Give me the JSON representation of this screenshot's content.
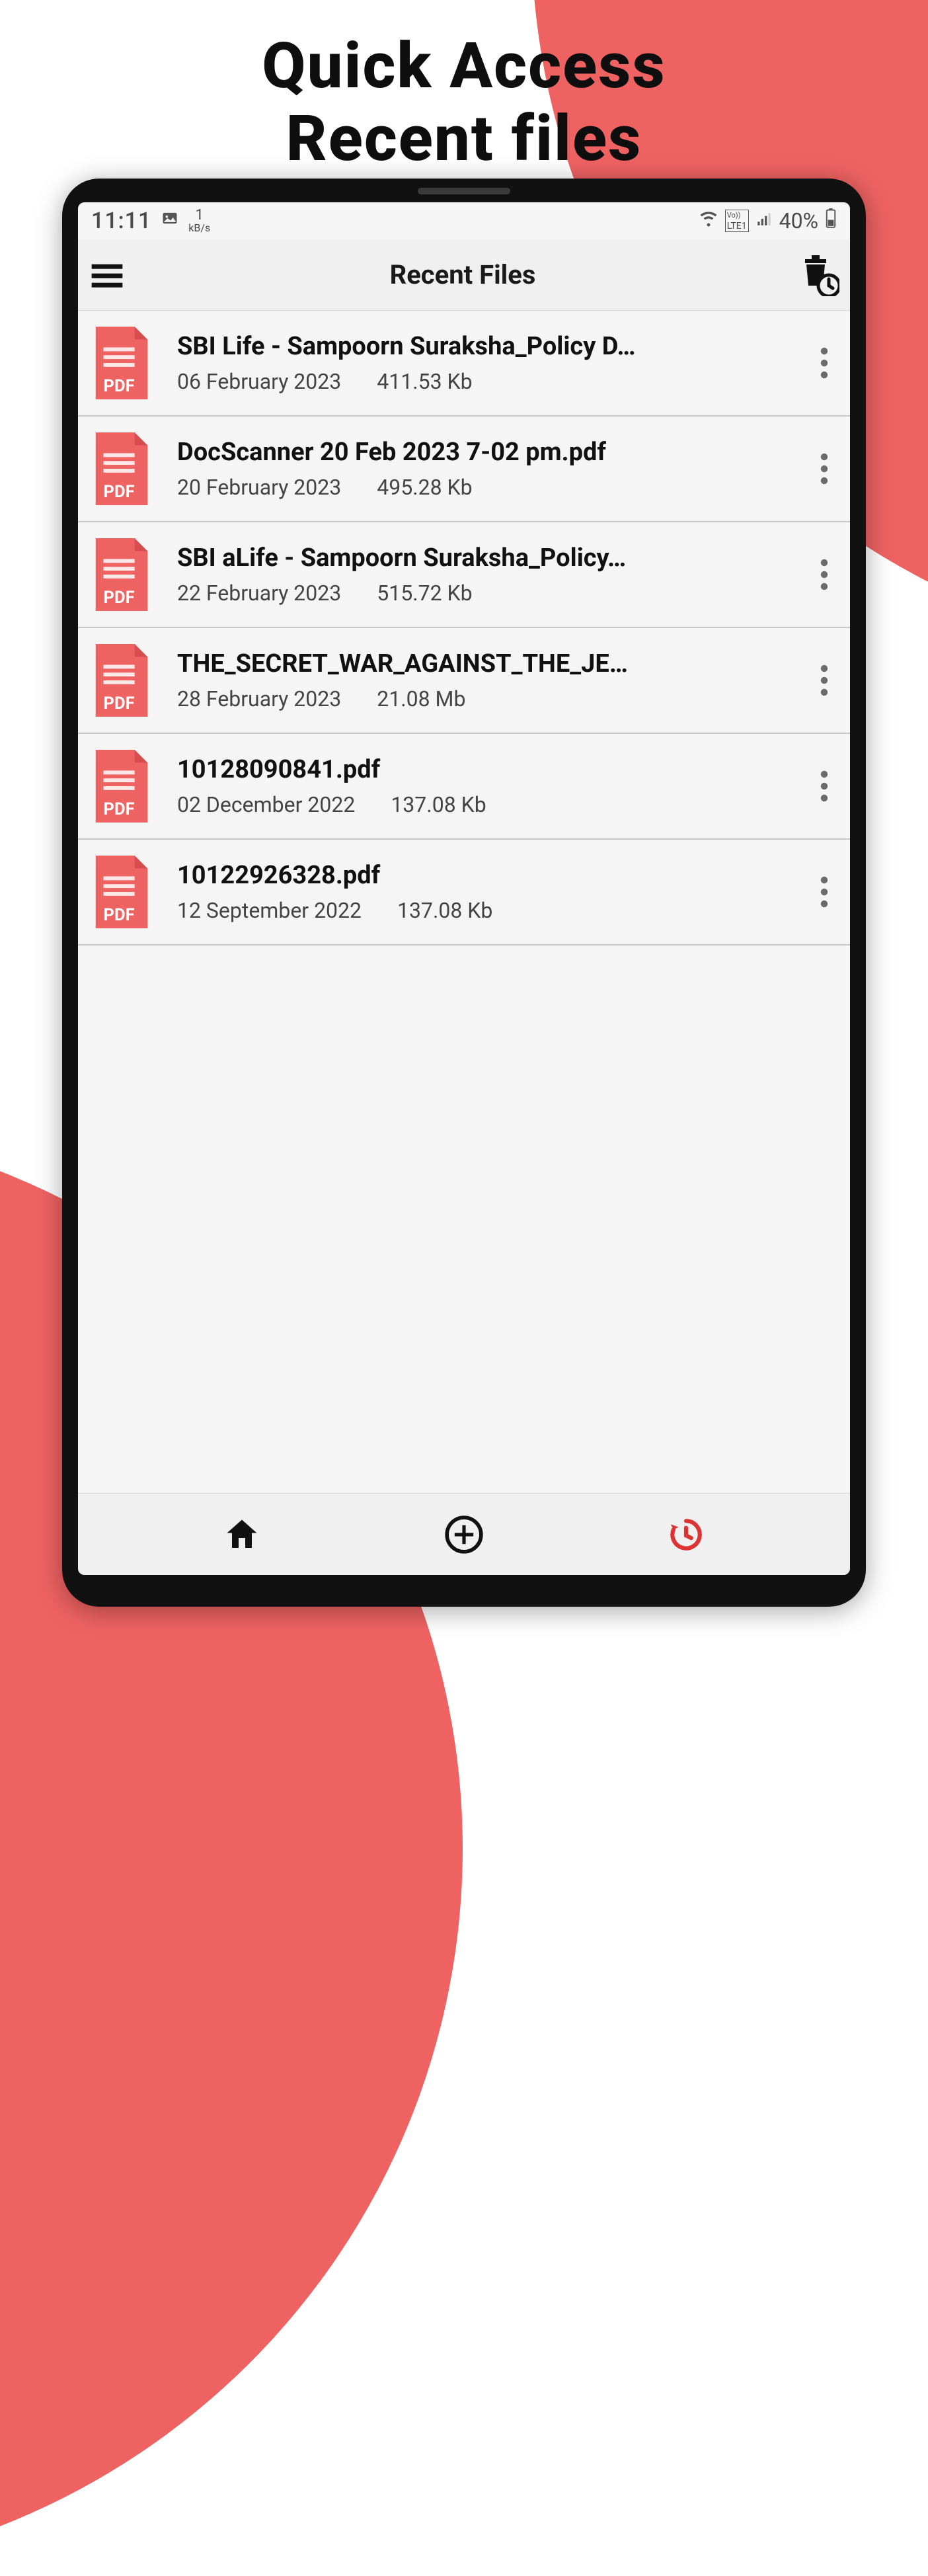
{
  "promo": {
    "line1": "Quick Access",
    "line2": "Recent files"
  },
  "statusbar": {
    "time": "11:11",
    "kbps": "1",
    "kbps_unit": "kB/s",
    "net": "LTE1",
    "battery": "40%"
  },
  "appbar": {
    "title": "Recent Files"
  },
  "files": [
    {
      "name": "SBI Life - Sampoorn Suraksha_Policy D…",
      "date": "06 February 2023",
      "size": "411.53 Kb"
    },
    {
      "name": "DocScanner 20 Feb 2023 7-02 pm.pdf",
      "date": "20 February 2023",
      "size": "495.28 Kb"
    },
    {
      "name": "SBI aLife - Sampoorn Suraksha_Policy…",
      "date": "22 February 2023",
      "size": "515.72 Kb"
    },
    {
      "name": "THE_SECRET_WAR_AGAINST_THE_JE…",
      "date": "28 February 2023",
      "size": "21.08 Mb"
    },
    {
      "name": "10128090841.pdf",
      "date": "02 December 2022",
      "size": "137.08 Kb"
    },
    {
      "name": "10122926328.pdf",
      "date": "12 September 2022",
      "size": "137.08 Kb"
    }
  ],
  "icons": {
    "pdf_label": "PDF"
  },
  "colors": {
    "accent": "#ef6262",
    "pdf": "#ef6262"
  }
}
